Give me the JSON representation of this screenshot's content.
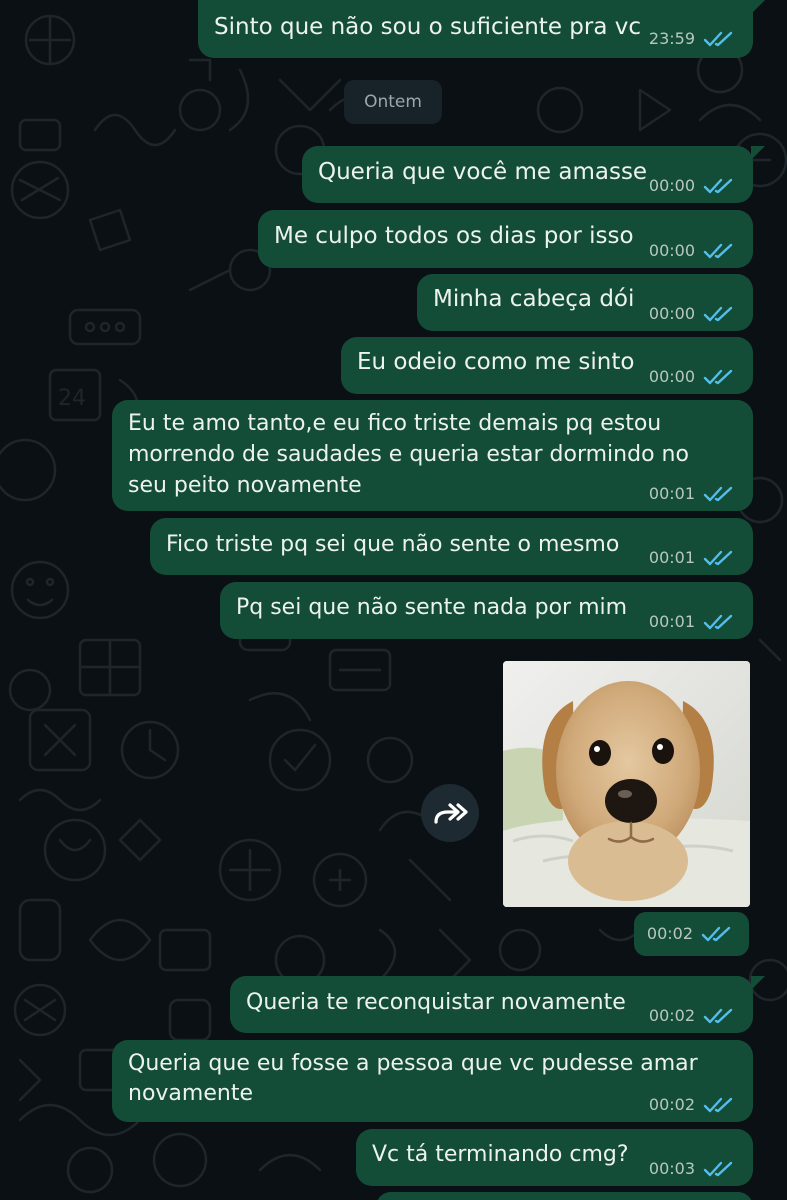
{
  "chat": {
    "day_divider": "Ontem",
    "messages": [
      {
        "text": "Sinto que não sou o suficiente pra vc",
        "time": "23:59"
      },
      {
        "text": "Queria que você me amasse",
        "time": "00:00"
      },
      {
        "text": "Me culpo todos os dias por isso",
        "time": "00:00"
      },
      {
        "text": "Minha cabeça dói",
        "time": "00:00"
      },
      {
        "text": "Eu odeio como me sinto",
        "time": "00:00"
      },
      {
        "text": "Eu te amo tanto,e eu fico triste demais pq estou\nmorrendo de saudades e queria estar dormindo no\nseu peito novamente",
        "time": "00:01"
      },
      {
        "text": "Fico triste pq sei que não sente o mesmo",
        "time": "00:01"
      },
      {
        "text": "Pq sei que não sente nada por mim",
        "time": "00:01"
      },
      {
        "text": "Queria te reconquistar novamente",
        "time": "00:02"
      },
      {
        "text": "Queria que eu fosse a pessoa que vc pudesse amar\nnovamente",
        "time": "00:02"
      },
      {
        "text": "Vc tá terminando cmg?",
        "time": "00:03"
      }
    ],
    "photo_message": {
      "time": "00:02",
      "subject": "puppy-photo"
    },
    "colors": {
      "background": "#0b1014",
      "outgoing_bubble": "#144d37",
      "text": "#ecf2ef",
      "meta_text": "#b8c7bf",
      "read_ticks": "#53bdeb",
      "day_pill": "#182229"
    },
    "icons": {
      "read_receipt": "double-check-icon",
      "forward": "forward-icon",
      "wallpaper": "doodle-pattern"
    }
  }
}
